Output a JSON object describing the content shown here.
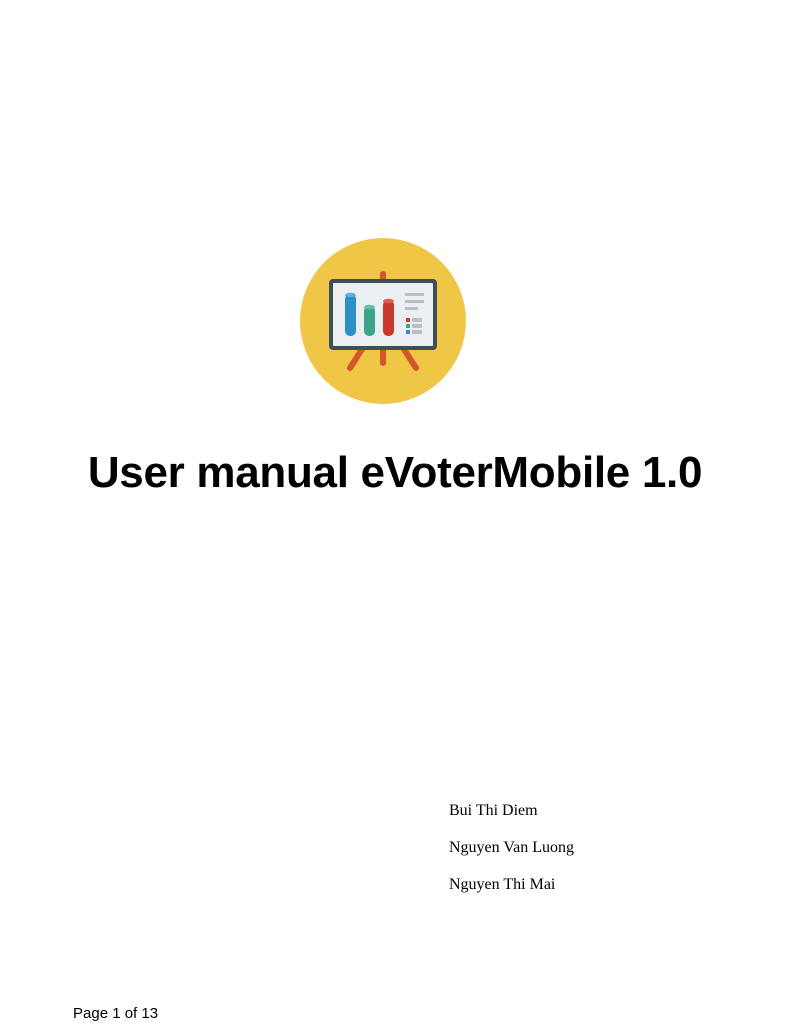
{
  "document": {
    "title": "User manual eVoterMobile 1.0",
    "authors": [
      "Bui Thi Diem",
      "Nguyen Van Luong",
      "Nguyen Thi Mai"
    ],
    "footer": "Page 1 of 13"
  },
  "logo": {
    "icon": "presentation-board-chart-icon",
    "colors": {
      "circle": "#F0C646",
      "board_frame": "#3F4F5A",
      "board_screen": "#EBEFF1",
      "easel": "#D4572B",
      "bar_blue": "#2C8FC5",
      "bar_green": "#3BA58C",
      "bar_red": "#C9392D",
      "lines_gray": "#B8BEC3"
    }
  }
}
